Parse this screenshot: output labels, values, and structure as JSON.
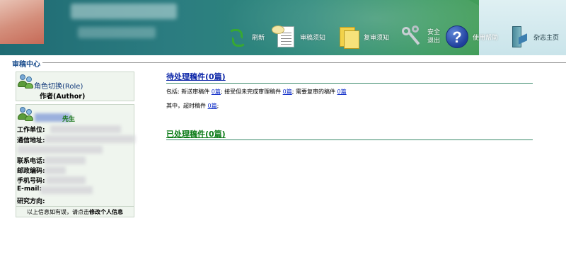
{
  "header": {
    "toolbar": [
      {
        "name": "refresh",
        "label": "刷新"
      },
      {
        "name": "review-notice",
        "label": "审稿须知"
      },
      {
        "name": "re-review-notice",
        "label": "复审须知"
      },
      {
        "name": "safe-logout",
        "label": "安全退出"
      },
      {
        "name": "help",
        "label": "使用帮助"
      },
      {
        "name": "journal-home",
        "label": "杂志主页"
      }
    ],
    "help_glyph": "?"
  },
  "section_title": "审稿中心",
  "sidebar": {
    "role": {
      "title": "角色切换(Role)",
      "value": "作者(Author)"
    },
    "profile": {
      "salutation": "先生",
      "fields": [
        "工作单位:",
        "通信地址:",
        "联系电话:",
        "邮政编码:",
        "手机号码:",
        "E-mail:",
        "研究方向:"
      ],
      "note_prefix": "以上信息如有误，请点击",
      "note_link": "修改个人信息"
    }
  },
  "main": {
    "pending": {
      "heading": "待处理稿件(0篇)",
      "line1": {
        "t1": "包括: 新送审稿件 ",
        "c1": "0篇",
        "t2": "; 接受但未完成审理稿件 ",
        "c2": "0篇",
        "t3": "; 需要复审的稿件 ",
        "c3": "0篇"
      },
      "line2": {
        "t1": "其中，超时稿件 ",
        "c1": "0篇",
        "t2": ";"
      }
    },
    "done": {
      "heading": "已处理稿件(0篇)"
    }
  },
  "colors": {
    "header_teal": "#2b7c80",
    "header_green": "#4ea24a",
    "pending_link": "#0b25a8",
    "done_link": "#0a7a16",
    "section_title": "#1d4f8e"
  }
}
